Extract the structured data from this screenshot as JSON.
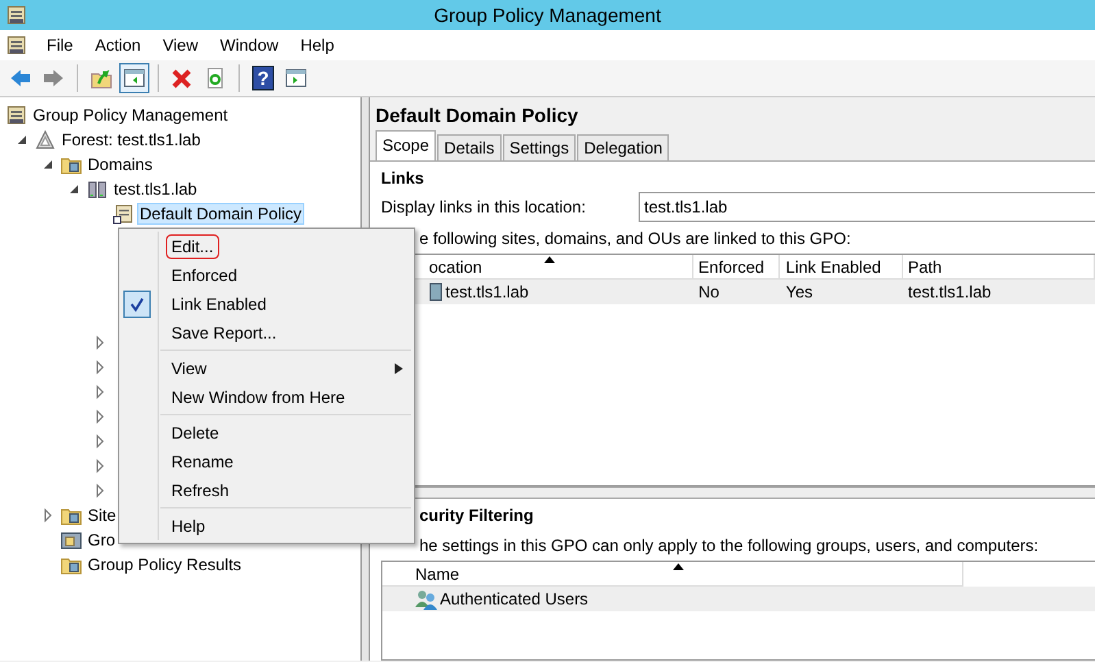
{
  "window": {
    "title": "Group Policy Management"
  },
  "menubar": [
    "File",
    "Action",
    "View",
    "Window",
    "Help"
  ],
  "toolbar": [
    {
      "kind": "back",
      "disabled": false
    },
    {
      "kind": "forward",
      "disabled": true
    },
    {
      "kind": "separator"
    },
    {
      "kind": "up"
    },
    {
      "kind": "tree-toggle",
      "pressed": true
    },
    {
      "kind": "separator"
    },
    {
      "kind": "delete"
    },
    {
      "kind": "export"
    },
    {
      "kind": "separator"
    },
    {
      "kind": "help",
      "label": "?"
    },
    {
      "kind": "action-pane"
    }
  ],
  "tree": {
    "label": "Group Policy Management",
    "selected": false,
    "children": [
      {
        "label": "Forest: test.tls1.lab",
        "expanded": true,
        "selected": false,
        "children": [
          {
            "label": "Domains",
            "expanded": true,
            "selected": false,
            "children": [
              {
                "label": "test.tls1.lab",
                "expanded": true,
                "selected": false,
                "children": [
                  {
                    "label": "Default Domain Policy",
                    "selected": true
                  },
                  {
                    "expanded": false
                  },
                  {
                    "expanded": false
                  },
                  {
                    "expanded": false
                  },
                  {
                    "expanded": false
                  },
                  {
                    "expanded": false
                  },
                  {
                    "expanded": false
                  },
                  {
                    "expanded": false
                  }
                ]
              }
            ]
          },
          {
            "label": "Site",
            "expanded": false,
            "selected": false
          },
          {
            "label": "Gro",
            "selected": false
          },
          {
            "label": "Group Policy Results",
            "selected": false
          }
        ]
      }
    ]
  },
  "details": {
    "title": "Default Domain Policy",
    "tabs": [
      {
        "label": "Scope",
        "selected": true
      },
      {
        "label": "Details",
        "selected": false
      },
      {
        "label": "Settings",
        "selected": false
      },
      {
        "label": "Delegation",
        "selected": false
      }
    ],
    "links": {
      "heading": "Links",
      "field_label": "Display links in this location:",
      "field_value": "test.tls1.lab",
      "caption": "e following sites, domains, and OUs are linked to this GPO:",
      "table": {
        "columns": [
          {
            "label": "ocation",
            "sorted": true
          },
          {
            "label": "Enforced",
            "sorted": false
          },
          {
            "label": "Link Enabled",
            "sorted": false
          },
          {
            "label": "Path",
            "sorted": false
          }
        ],
        "rows": [
          {
            "cells": [
              "test.tls1.lab",
              "No",
              "Yes",
              "test.tls1.lab"
            ],
            "selected": true
          }
        ]
      }
    },
    "security": {
      "heading": "curity Filtering",
      "caption": "he settings in this GPO can only apply to the following groups, users, and computers:",
      "table": {
        "columns": [
          {
            "label": "Name",
            "sorted": true
          }
        ],
        "rows": [
          {
            "cells": [
              "Authenticated Users"
            ],
            "selected": true
          }
        ]
      }
    }
  },
  "context_menu": [
    {
      "kind": "item",
      "label": "Edit...",
      "outlined": true,
      "checked": false,
      "submenu": false
    },
    {
      "kind": "item",
      "label": "Enforced",
      "outlined": false,
      "checked": false,
      "submenu": false
    },
    {
      "kind": "item",
      "label": "Link Enabled",
      "outlined": false,
      "checked": true,
      "submenu": false
    },
    {
      "kind": "item",
      "label": "Save Report...",
      "outlined": false,
      "checked": false,
      "submenu": false
    },
    {
      "kind": "separator"
    },
    {
      "kind": "item",
      "label": "View",
      "outlined": false,
      "checked": false,
      "submenu": true
    },
    {
      "kind": "item",
      "label": "New Window from Here",
      "outlined": false,
      "checked": false,
      "submenu": false
    },
    {
      "kind": "separator"
    },
    {
      "kind": "item",
      "label": "Delete",
      "outlined": false,
      "checked": false,
      "submenu": false
    },
    {
      "kind": "item",
      "label": "Rename",
      "outlined": false,
      "checked": false,
      "submenu": false
    },
    {
      "kind": "item",
      "label": "Refresh",
      "outlined": false,
      "checked": false,
      "submenu": false
    },
    {
      "kind": "separator"
    },
    {
      "kind": "item",
      "label": "Help",
      "outlined": false,
      "checked": false,
      "submenu": false
    }
  ]
}
